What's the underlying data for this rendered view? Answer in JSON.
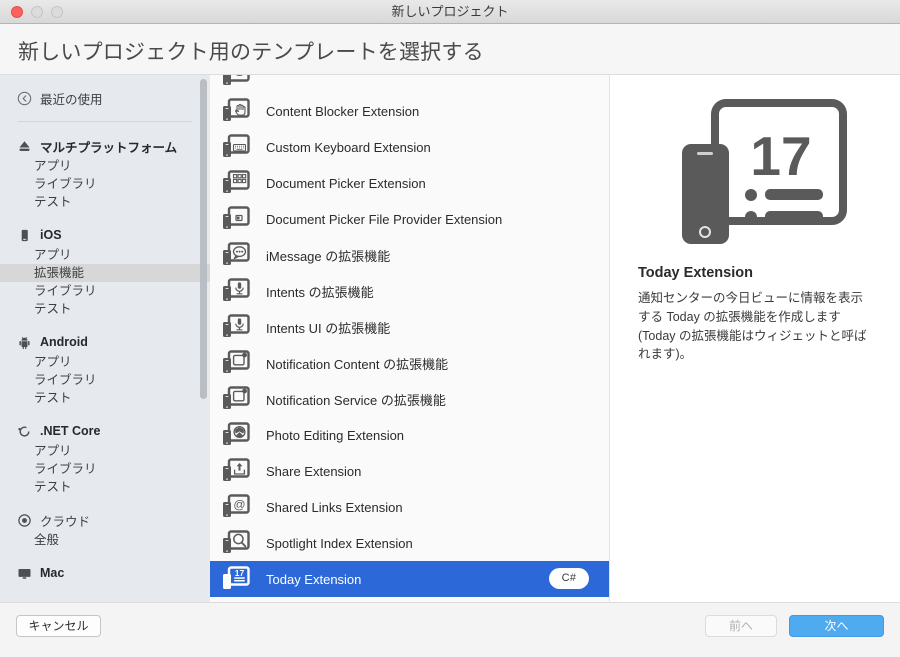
{
  "window": {
    "title": "新しいプロジェクト",
    "traffic_lights": [
      "close",
      "minimize",
      "maximize"
    ]
  },
  "header": {
    "title": "新しいプロジェクト用のテンプレートを選択する"
  },
  "sidebar": {
    "recent": {
      "icon": "clock-back-icon",
      "label": "最近の使用"
    },
    "groups": [
      {
        "icon": "multiplatform-icon",
        "label": "マルチプラットフォーム",
        "bold": true,
        "items": [
          {
            "label": "アプリ",
            "selected": false
          },
          {
            "label": "ライブラリ",
            "selected": false
          },
          {
            "label": "テスト",
            "selected": false
          }
        ]
      },
      {
        "icon": "iphone-icon",
        "label": "iOS",
        "bold": true,
        "items": [
          {
            "label": "アプリ",
            "selected": false
          },
          {
            "label": "拡張機能",
            "selected": true
          },
          {
            "label": "ライブラリ",
            "selected": false
          },
          {
            "label": "テスト",
            "selected": false
          }
        ]
      },
      {
        "icon": "android-icon",
        "label": "Android",
        "bold": true,
        "items": [
          {
            "label": "アプリ",
            "selected": false
          },
          {
            "label": "ライブラリ",
            "selected": false
          },
          {
            "label": "テスト",
            "selected": false
          }
        ]
      },
      {
        "icon": "dotnet-core-icon",
        "label": ".NET Core",
        "bold": true,
        "items": [
          {
            "label": "アプリ",
            "selected": false
          },
          {
            "label": "ライブラリ",
            "selected": false
          },
          {
            "label": "テスト",
            "selected": false
          }
        ]
      },
      {
        "icon": "cloud-target-icon",
        "label": "クラウド",
        "bold": false,
        "items": [
          {
            "label": "全般",
            "selected": false
          }
        ]
      },
      {
        "icon": "mac-display-icon",
        "label": "Mac",
        "bold": true,
        "items": []
      }
    ]
  },
  "list": {
    "rows": [
      {
        "label": "",
        "icon": "device-pair-partial-icon",
        "partial": true,
        "selected": false,
        "badge": ""
      },
      {
        "label": "Content Blocker Extension",
        "icon": "device-pair-hand-icon",
        "selected": false,
        "badge": ""
      },
      {
        "label": "Custom Keyboard Extension",
        "icon": "device-pair-keyboard-icon",
        "selected": false,
        "badge": ""
      },
      {
        "label": "Document Picker Extension",
        "icon": "device-pair-grid-icon",
        "selected": false,
        "badge": ""
      },
      {
        "label": "Document Picker File Provider Extension",
        "icon": "device-pair-file-icon",
        "selected": false,
        "badge": ""
      },
      {
        "label": "iMessage の拡張機能",
        "icon": "device-pair-message-icon",
        "selected": false,
        "badge": ""
      },
      {
        "label": "Intents の拡張機能",
        "icon": "device-pair-mic-icon",
        "selected": false,
        "badge": ""
      },
      {
        "label": "Intents UI の拡張機能",
        "icon": "device-pair-mic-icon",
        "selected": false,
        "badge": ""
      },
      {
        "label": "Notification Content の拡張機能",
        "icon": "device-pair-notification-icon",
        "selected": false,
        "badge": ""
      },
      {
        "label": "Notification Service の拡張機能",
        "icon": "device-pair-notification-icon",
        "selected": false,
        "badge": ""
      },
      {
        "label": "Photo Editing Extension",
        "icon": "device-pair-photo-icon",
        "selected": false,
        "badge": ""
      },
      {
        "label": "Share Extension",
        "icon": "device-pair-share-icon",
        "selected": false,
        "badge": ""
      },
      {
        "label": "Shared Links Extension",
        "icon": "device-pair-at-icon",
        "selected": false,
        "badge": ""
      },
      {
        "label": "Spotlight Index Extension",
        "icon": "device-pair-search-icon",
        "selected": false,
        "badge": ""
      },
      {
        "label": "Today Extension",
        "icon": "device-pair-today-icon",
        "selected": true,
        "badge": "C#"
      }
    ]
  },
  "detail": {
    "art_icon": "today-extension-art",
    "art_day_number": "17",
    "title": "Today Extension",
    "description": "通知センターの今日ビューに情報を表示する Today の拡張機能を作成します (Today の拡張機能はウィジェットと呼ばれます)。"
  },
  "footer": {
    "cancel_label": "キャンセル",
    "previous_label": "前へ",
    "next_label": "次へ"
  },
  "colors": {
    "selection_blue": "#2d68d8",
    "primary_button": "#50aaf0",
    "sidebar_bg": "#e6eaee",
    "icon_gray": "#5a5a5a"
  }
}
